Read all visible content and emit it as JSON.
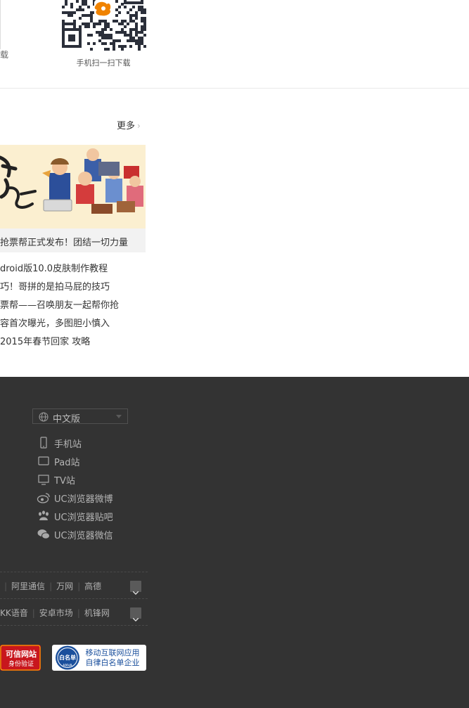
{
  "top": {
    "left_caption": "载",
    "qr_caption": "手机扫一扫下载"
  },
  "news": {
    "more_label": "更多",
    "banner_caption": "抢票帮正式发布！团结一切力量",
    "items": [
      "droid版10.0皮肤制作教程",
      "巧！哥拼的是拍马屁的技巧",
      "票帮——召唤朋友一起帮你抢",
      "容首次曝光，多图胆小慎入",
      " 2015年春节回家 攻略"
    ]
  },
  "footer": {
    "language": "中文版",
    "links": [
      {
        "label": "手机站",
        "icon": "mobile-icon"
      },
      {
        "label": "Pad站",
        "icon": "tablet-icon"
      },
      {
        "label": "TV站",
        "icon": "tv-icon"
      },
      {
        "label": "UC浏览器微博",
        "icon": "weibo-icon"
      },
      {
        "label": "UC浏览器贴吧",
        "icon": "tieba-paw-icon"
      },
      {
        "label": "UC浏览器微信",
        "icon": "wechat-icon"
      }
    ],
    "partner_row_1": [
      "阿里通信",
      "万网",
      "高德"
    ],
    "partner_row_2": [
      "KK语音",
      "安卓市场",
      "机锋网"
    ],
    "badge_credible": {
      "line1": "可信网站",
      "line2": "身份验证"
    },
    "badge_whitelist": {
      "seal": "白名单",
      "seal_sub": "ANVA",
      "line1": "移动互联网应用",
      "line2": "自律白名单企业"
    }
  },
  "colors": {
    "footer_bg": "#333333",
    "badge_red": "#c8161d",
    "badge_blue": "#1a4f9c"
  }
}
